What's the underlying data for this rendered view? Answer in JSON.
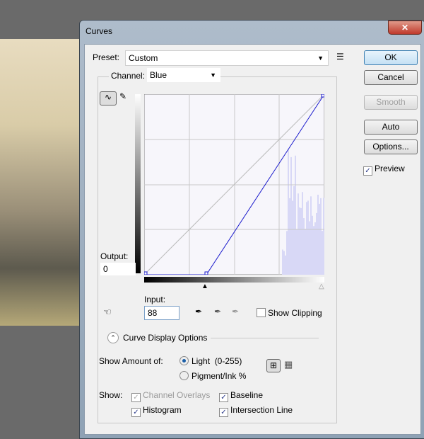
{
  "title": "Curves",
  "preset": {
    "label": "Preset:",
    "value": "Custom"
  },
  "channel": {
    "label": "Channel:",
    "value": "Blue"
  },
  "buttons": {
    "ok": "OK",
    "cancel": "Cancel",
    "smooth": "Smooth",
    "auto": "Auto",
    "options": "Options..."
  },
  "preview": {
    "label": "Preview",
    "checked": true
  },
  "output": {
    "label": "Output:",
    "value": "0"
  },
  "input": {
    "label": "Input:",
    "value": "88"
  },
  "show_clipping": {
    "label": "Show Clipping",
    "checked": false
  },
  "curve_display_options": "Curve Display Options",
  "show_amount": {
    "label": "Show Amount of:",
    "light": "Light  (0-255)",
    "pigment": "Pigment/Ink %",
    "selected": "light"
  },
  "show": {
    "label": "Show:",
    "channel_overlays": "Channel Overlays",
    "baseline": "Baseline",
    "histogram": "Histogram",
    "intersection_line": "Intersection Line",
    "checked": {
      "channel_overlays": true,
      "baseline": true,
      "histogram": true,
      "intersection_line": true
    }
  },
  "curve": {
    "points": [
      [
        0,
        0
      ],
      [
        88,
        0
      ],
      [
        255,
        255
      ]
    ],
    "color": "#1a1acc"
  }
}
